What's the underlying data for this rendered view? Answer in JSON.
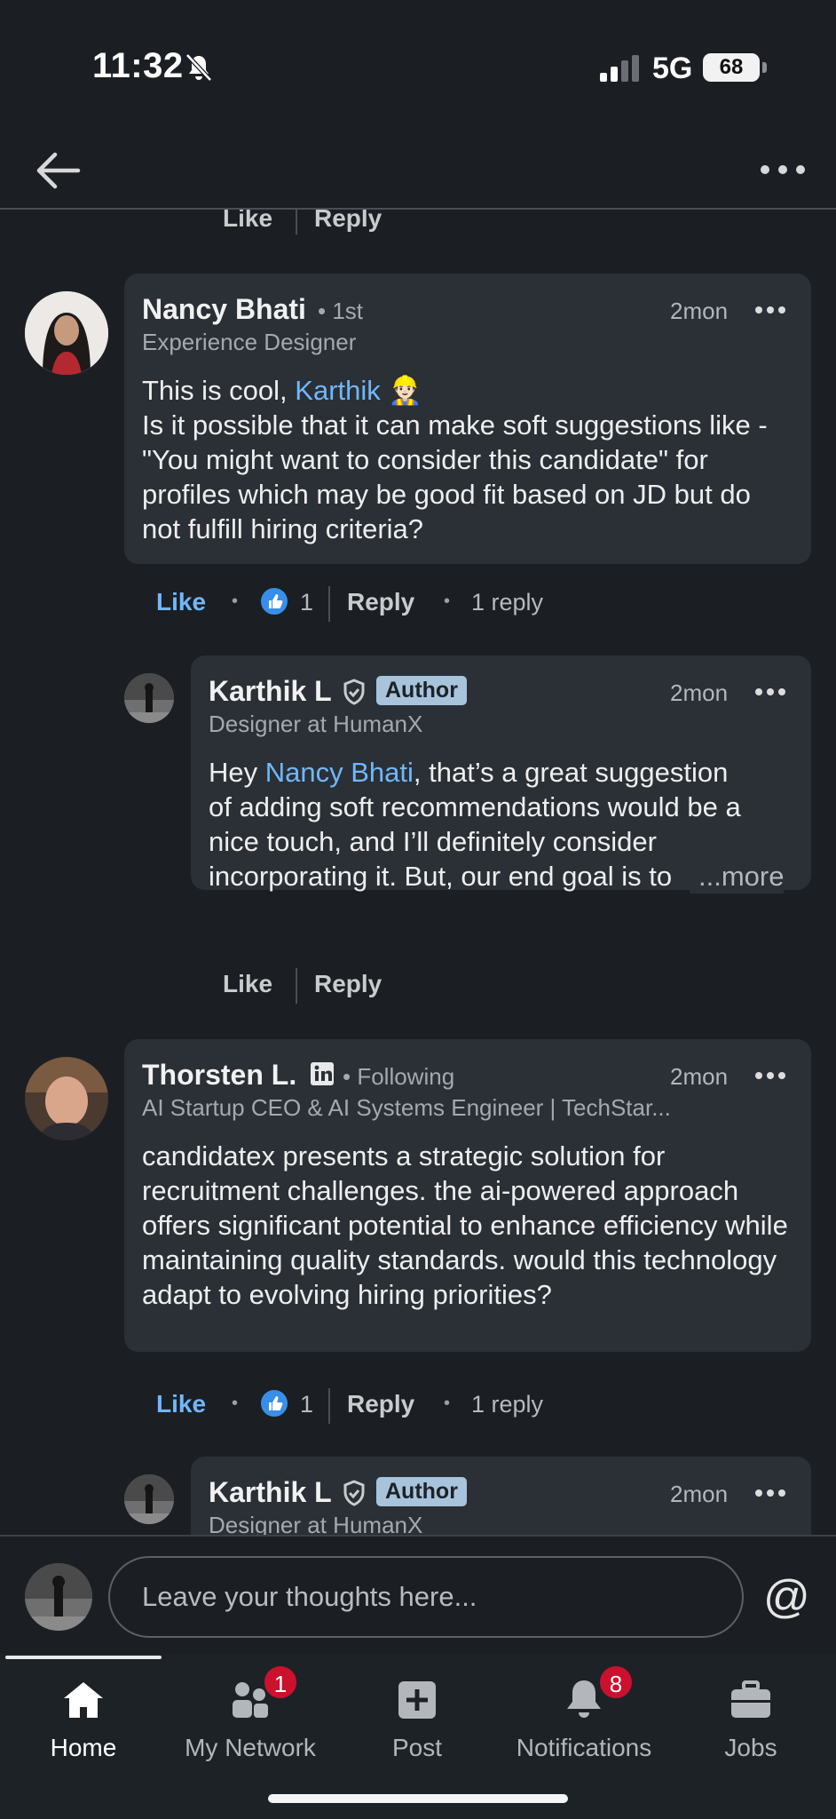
{
  "status_bar": {
    "time": "11:32",
    "network": "5G",
    "battery": "68"
  },
  "top_nav": {
    "back_icon": "arrow-left-icon",
    "more_icon": "more-horizontal-icon"
  },
  "thread": {
    "prev_actions": {
      "like": "Like",
      "reply": "Reply"
    },
    "comments": [
      {
        "name": "Nancy Bhati",
        "degree": "• 1st",
        "headline": "Experience Designer",
        "time": "2mon",
        "text_prefix": "This is cool, ",
        "mention": "Karthik",
        "emoji": "👷🏻",
        "text_rest": "Is it possible that it can make soft suggestions like - \"You might want to consider this candidate\" for profiles which may be good fit based on JD but do not fulfill hiring criteria?",
        "actions": {
          "like": "Like",
          "reaction_count": "1",
          "reply": "Reply",
          "replies": "1 reply"
        },
        "reply": {
          "name": "Karthik L",
          "badge": "Author",
          "headline": "Designer at HumanX",
          "time": "2mon",
          "text_prefix": "Hey ",
          "mention": "Nancy Bhati",
          "text_rest": ", that’s a great suggestion of adding soft recommendations would be a nice touch, and I’ll definitely consider incorporating it. But, our end goal is to update the status on Recruit CRM",
          "more": "...more",
          "actions": {
            "like": "Like",
            "reply": "Reply"
          }
        }
      },
      {
        "name": "Thorsten L.",
        "degree": "• Following",
        "headline": "AI Startup CEO & AI Systems Engineer | TechStar...",
        "time": "2mon",
        "text": "candidatex presents a strategic solution for recruitment challenges. the ai-powered approach offers significant potential to enhance efficiency while maintaining quality standards. would this technology adapt to evolving hiring priorities?",
        "actions": {
          "like": "Like",
          "reaction_count": "1",
          "reply": "Reply",
          "replies": "1 reply"
        },
        "reply": {
          "name": "Karthik L",
          "badge": "Author",
          "headline": "Designer at HumanX",
          "time": "2mon"
        }
      }
    ]
  },
  "composer": {
    "placeholder": "Leave your thoughts here...",
    "mention_symbol": "@"
  },
  "bottom_nav": {
    "items": [
      {
        "label": "Home",
        "icon": "home-icon",
        "active": true
      },
      {
        "label": "My Network",
        "icon": "network-icon",
        "badge": "1"
      },
      {
        "label": "Post",
        "icon": "post-icon"
      },
      {
        "label": "Notifications",
        "icon": "bell-icon",
        "badge": "8"
      },
      {
        "label": "Jobs",
        "icon": "briefcase-icon"
      }
    ]
  },
  "colors": {
    "background": "#1b1f23",
    "bubble": "#2a3036",
    "accent": "#71b7fb",
    "badge_red": "#cb112d"
  }
}
